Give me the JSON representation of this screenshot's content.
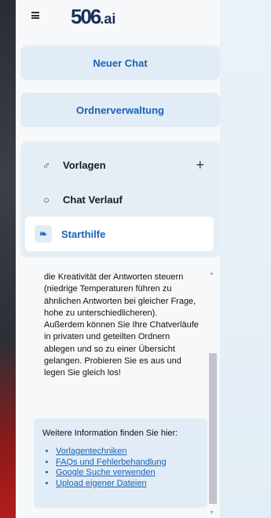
{
  "header": {
    "logo_text": "506",
    "logo_suffix": ".ai"
  },
  "actions": {
    "new_chat": "Neuer Chat",
    "folder_management": "Ordnerverwaltung"
  },
  "nav": {
    "templates": {
      "label": "Vorlagen",
      "icon": "templates-icon",
      "add": "+"
    },
    "history": {
      "label": "Chat Verlauf",
      "icon": "chat-bubble-icon"
    },
    "help": {
      "label": "Starthilfe",
      "icon": "leaf-icon"
    }
  },
  "help_content": {
    "paragraph": "die Kreativität der Antworten steuern (niedrige Temperaturen führen zu ähnlichen Antworten bei gleicher Frage, hohe zu unterschiedlicheren). Außerdem können Sie Ihre Chatverläufe in privaten und geteilten Ordnern ablegen und so zu einer Übersicht gelangen. Probieren Sie es aus und legen Sie gleich los!",
    "info_title": "Weitere Information finden Sie hier:",
    "links": [
      "Vorlagentechniken",
      "FAQs und Fehlerbehandlung",
      "Google Suche verwenden",
      "Upload eigener Dateien"
    ]
  },
  "colors": {
    "accent": "#1a62b5",
    "button_bg": "#e1ecf6",
    "logo": "#1a2f5c"
  }
}
